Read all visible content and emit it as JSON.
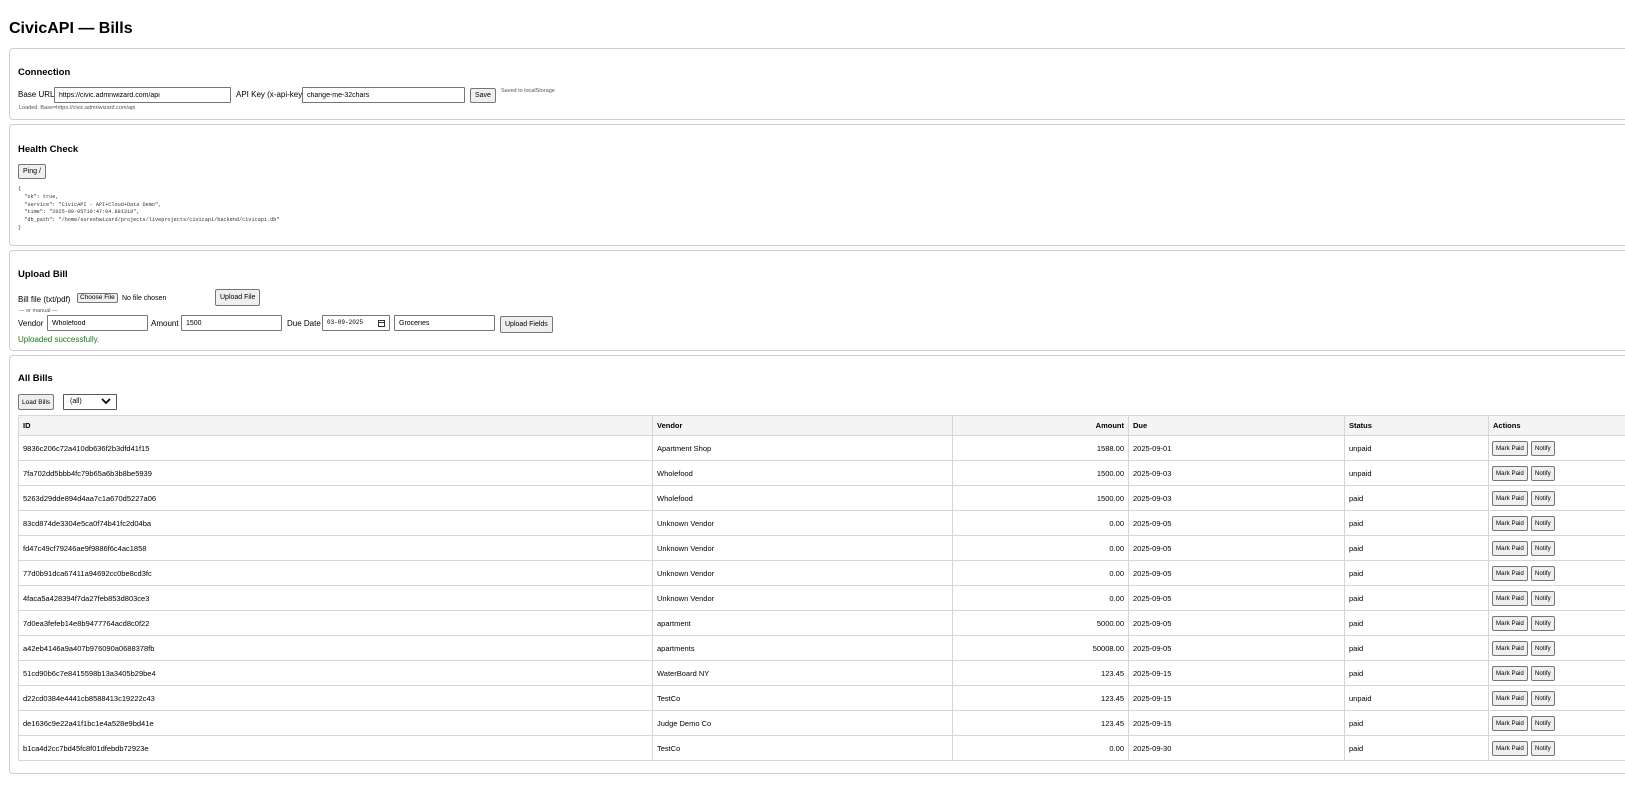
{
  "page": {
    "title": "CivicAPI — Bills"
  },
  "connection": {
    "heading": "Connection",
    "base_url_label": "Base URL",
    "base_url_value": "https://civic.admnwizard.com/api",
    "api_key_label": "API Key (x-api-key)",
    "api_key_value": "change-me-32chars",
    "save_label": "Save",
    "saved_note": "Saved to localStorage",
    "loaded_note": "Loaded. Base=https://civic.admnwizard.com/api"
  },
  "health": {
    "heading": "Health Check",
    "ping_label": "Ping /",
    "response": "{\n  \"ok\": true,\n  \"service\": \"CivicAPI - API+Cloud+Data Demo\",\n  \"time\": \"2025-09-05T10:47:04.881310\",\n  \"db_path\": \"/home/sureshwizard/projects/liveprojects/civicapi/backend/civicapi.db\"\n}"
  },
  "upload": {
    "heading": "Upload Bill",
    "file_label": "Bill file (txt/pdf)",
    "choose_file_label": "Choose File",
    "no_file_text": "No file chosen",
    "upload_file_label": "Upload File",
    "or_manual": "— or manual —",
    "vendor_label": "Vendor",
    "vendor_value": "Wholefood",
    "amount_label": "Amount",
    "amount_value": "1500",
    "due_label": "Due Date",
    "due_value": "03-09-2025",
    "category_value": "Groceries",
    "upload_fields_label": "Upload Fields",
    "status_text": "Uploaded successfully."
  },
  "bills": {
    "heading": "All Bills",
    "load_label": "Load Bills",
    "filter_value": "(all)",
    "columns": {
      "id": "ID",
      "vendor": "Vendor",
      "amount": "Amount",
      "due": "Due",
      "status": "Status",
      "actions": "Actions"
    },
    "mark_paid_label": "Mark Paid",
    "notify_label": "Notify",
    "rows": [
      {
        "id": "9836c206c72a410db636f2b3dfd41f15",
        "vendor": "Apartment Shop",
        "amount": "1588.00",
        "due": "2025-09-01",
        "status": "unpaid"
      },
      {
        "id": "7fa702dd5bbb4fc79b65a6b3b8be5939",
        "vendor": "Wholefood",
        "amount": "1500.00",
        "due": "2025-09-03",
        "status": "unpaid"
      },
      {
        "id": "5263d29dde894d4aa7c1a670d5227a06",
        "vendor": "Wholefood",
        "amount": "1500.00",
        "due": "2025-09-03",
        "status": "paid"
      },
      {
        "id": "83cd874de3304e5ca0f74b41fc2d04ba",
        "vendor": "Unknown Vendor",
        "amount": "0.00",
        "due": "2025-09-05",
        "status": "paid"
      },
      {
        "id": "fd47c49cf79246ae9f9886f6c4ac1858",
        "vendor": "Unknown Vendor",
        "amount": "0.00",
        "due": "2025-09-05",
        "status": "paid"
      },
      {
        "id": "77d0b91dca67411a94692cc0be8cd3fc",
        "vendor": "Unknown Vendor",
        "amount": "0.00",
        "due": "2025-09-05",
        "status": "paid"
      },
      {
        "id": "4faca5a428394f7da27feb853d803ce3",
        "vendor": "Unknown Vendor",
        "amount": "0.00",
        "due": "2025-09-05",
        "status": "paid"
      },
      {
        "id": "7d0ea3fefeb14e8b9477764acd8c0f22",
        "vendor": "apartment",
        "amount": "5000.00",
        "due": "2025-09-05",
        "status": "paid"
      },
      {
        "id": "a42eb4146a9a407b976090a0688378fb",
        "vendor": "apartments",
        "amount": "50008.00",
        "due": "2025-09-05",
        "status": "paid"
      },
      {
        "id": "51cd90b6c7e8415598b13a3405b29be4",
        "vendor": "WaterBoard NY",
        "amount": "123.45",
        "due": "2025-09-15",
        "status": "paid"
      },
      {
        "id": "d22cd0384e4441cb8588413c19222c43",
        "vendor": "TestCo",
        "amount": "123.45",
        "due": "2025-09-15",
        "status": "unpaid"
      },
      {
        "id": "de1636c9e22a41f1bc1e4a528e9bd41e",
        "vendor": "Judge Demo Co",
        "amount": "123.45",
        "due": "2025-09-15",
        "status": "paid"
      },
      {
        "id": "b1ca4d2cc7bd45fc8f01dfebdb72923e",
        "vendor": "TestCo",
        "amount": "0.00",
        "due": "2025-09-30",
        "status": "paid"
      }
    ]
  }
}
